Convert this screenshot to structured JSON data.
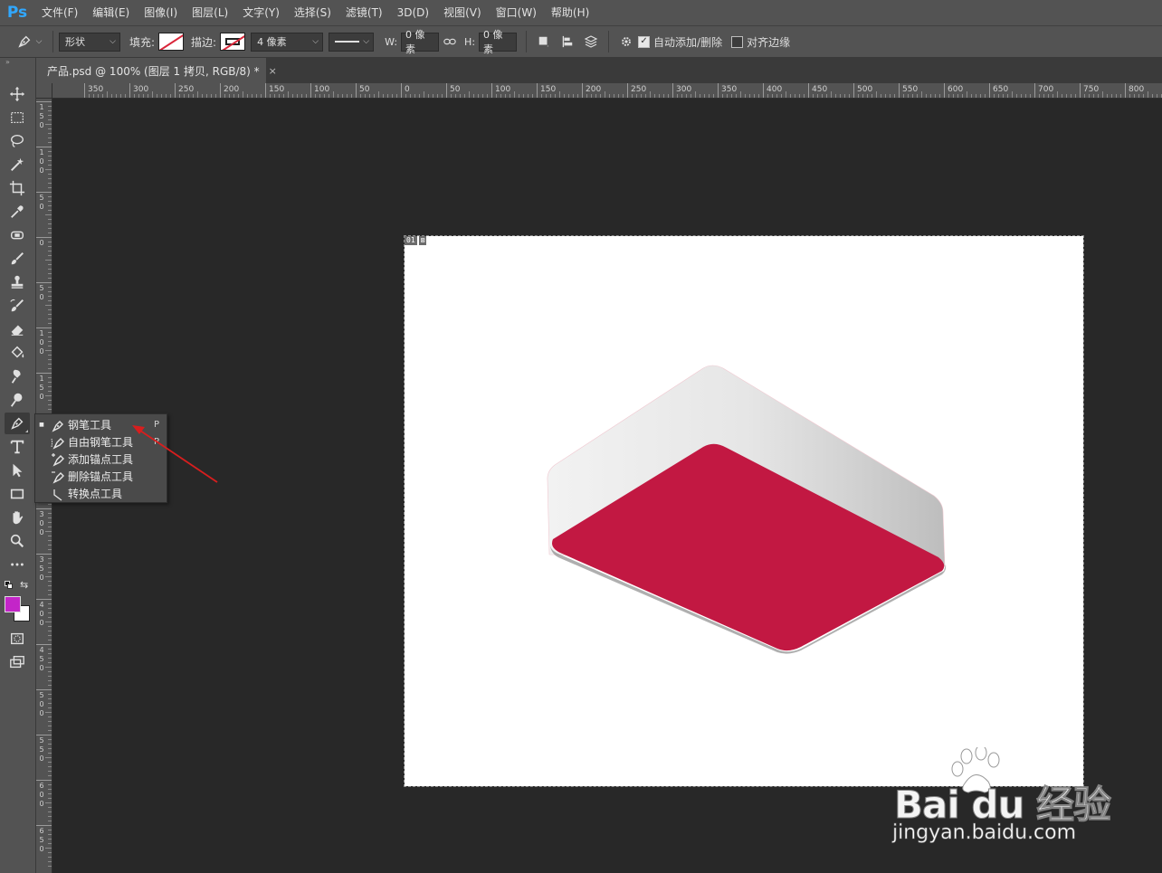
{
  "app": {
    "logo": "Ps",
    "menu": [
      "文件(F)",
      "编辑(E)",
      "图像(I)",
      "图层(L)",
      "文字(Y)",
      "选择(S)",
      "滤镜(T)",
      "3D(D)",
      "视图(V)",
      "窗口(W)",
      "帮助(H)"
    ]
  },
  "options": {
    "tool_icon": "pen-icon",
    "mode": "形状",
    "fill_label": "填充:",
    "stroke_label": "描边:",
    "stroke_width": "4 像素",
    "w_label": "W:",
    "w_value": "0 像素",
    "link_icon": "link-icon",
    "h_label": "H:",
    "h_value": "0 像素",
    "auto_add_delete_checked": true,
    "auto_add_delete_label": "自动添加/删除",
    "align_edges_checked": false,
    "align_edges_label": "对齐边缘"
  },
  "document": {
    "tab_title": "产品.psd @ 100% (图层 1 拷贝, RGB/8) *",
    "close": "×",
    "layer_badge": "01"
  },
  "rulers": {
    "top_labels": [
      "350",
      "300",
      "250",
      "200",
      "150",
      "100",
      "50",
      "0",
      "50",
      "100",
      "150",
      "200",
      "250",
      "300",
      "350",
      "400",
      "450",
      "500",
      "550",
      "600",
      "650",
      "700",
      "750",
      "800"
    ],
    "left_labels": [
      "150",
      "100",
      "50",
      "0",
      "50",
      "100",
      "150",
      "200",
      "250",
      "300",
      "350",
      "400",
      "450",
      "500",
      "550",
      "600",
      "650"
    ]
  },
  "tools": [
    {
      "name": "move-tool",
      "icon": "move-icon"
    },
    {
      "name": "marquee-tool",
      "icon": "rect-marquee-icon"
    },
    {
      "name": "lasso-tool",
      "icon": "lasso-icon"
    },
    {
      "name": "magic-wand-tool",
      "icon": "magic-wand-icon"
    },
    {
      "name": "crop-tool",
      "icon": "crop-icon"
    },
    {
      "name": "eyedropper-tool",
      "icon": "eyedropper-icon"
    },
    {
      "name": "healing-tool",
      "icon": "bandage-icon"
    },
    {
      "name": "brush-tool",
      "icon": "brush-icon"
    },
    {
      "name": "stamp-tool",
      "icon": "stamp-icon"
    },
    {
      "name": "history-brush-tool",
      "icon": "history-brush-icon"
    },
    {
      "name": "eraser-tool",
      "icon": "eraser-icon"
    },
    {
      "name": "paint-bucket-tool",
      "icon": "bucket-icon"
    },
    {
      "name": "blur-tool",
      "icon": "smudge-icon"
    },
    {
      "name": "dodge-tool",
      "icon": "dodge-icon"
    },
    {
      "name": "pen-tool",
      "icon": "pen-icon"
    },
    {
      "name": "type-tool",
      "icon": "type-icon"
    },
    {
      "name": "path-select-tool",
      "icon": "arrow-icon"
    },
    {
      "name": "shape-tool",
      "icon": "rectangle-icon"
    },
    {
      "name": "hand-tool",
      "icon": "hand-icon"
    },
    {
      "name": "zoom-tool",
      "icon": "zoom-icon"
    },
    {
      "name": "more-tools",
      "icon": "ellipsis-icon"
    }
  ],
  "colors": {
    "foreground": "#c325c8",
    "background": "#ffffff",
    "box_face": "#c21842",
    "box_side": "#ececec",
    "accent_arrow": "#d81e1e"
  },
  "flyout": [
    {
      "label": "钢笔工具",
      "key": "P",
      "selected": true,
      "icon": "pen-icon"
    },
    {
      "label": "自由钢笔工具",
      "key": "P",
      "selected": false,
      "icon": "freeform-pen-icon"
    },
    {
      "label": "添加锚点工具",
      "key": "",
      "selected": false,
      "icon": "add-anchor-icon"
    },
    {
      "label": "删除锚点工具",
      "key": "",
      "selected": false,
      "icon": "delete-anchor-icon"
    },
    {
      "label": "转换点工具",
      "key": "",
      "selected": false,
      "icon": "convert-point-icon"
    }
  ],
  "watermark": {
    "brand": "Bai du 经验",
    "url": "jingyan.baidu.com"
  }
}
